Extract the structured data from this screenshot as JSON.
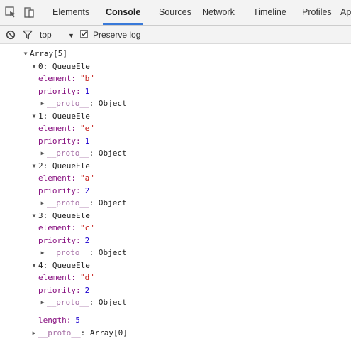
{
  "tabs": {
    "items": [
      "Elements",
      "Console",
      "Sources",
      "Network",
      "Timeline",
      "Profiles",
      "Ap"
    ],
    "active": "Console"
  },
  "filter": {
    "context": "top",
    "preserve_log_label": "Preserve log",
    "preserve_log_checked": true
  },
  "console": {
    "array_label": "Array[5]",
    "items": [
      {
        "index_label": "0: QueueEle",
        "element_key": "element:",
        "element_value": "\"b\"",
        "priority_key": "priority:",
        "priority_value": "1",
        "proto_key": "__proto__",
        "proto_value": ": Object"
      },
      {
        "index_label": "1: QueueEle",
        "element_key": "element:",
        "element_value": "\"e\"",
        "priority_key": "priority:",
        "priority_value": "1",
        "proto_key": "__proto__",
        "proto_value": ": Object"
      },
      {
        "index_label": "2: QueueEle",
        "element_key": "element:",
        "element_value": "\"a\"",
        "priority_key": "priority:",
        "priority_value": "2",
        "proto_key": "__proto__",
        "proto_value": ": Object"
      },
      {
        "index_label": "3: QueueEle",
        "element_key": "element:",
        "element_value": "\"c\"",
        "priority_key": "priority:",
        "priority_value": "2",
        "proto_key": "__proto__",
        "proto_value": ": Object"
      },
      {
        "index_label": "4: QueueEle",
        "element_key": "element:",
        "element_value": "\"d\"",
        "priority_key": "priority:",
        "priority_value": "2",
        "proto_key": "__proto__",
        "proto_value": ": Object"
      }
    ],
    "length_key": "length:",
    "length_value": "5",
    "array_proto_key": "__proto__",
    "array_proto_value": ": Array[0]"
  },
  "colors": {
    "key": "#881280",
    "string": "#c41a16",
    "number": "#1c00cf",
    "active_tab_underline": "#3879d9"
  }
}
